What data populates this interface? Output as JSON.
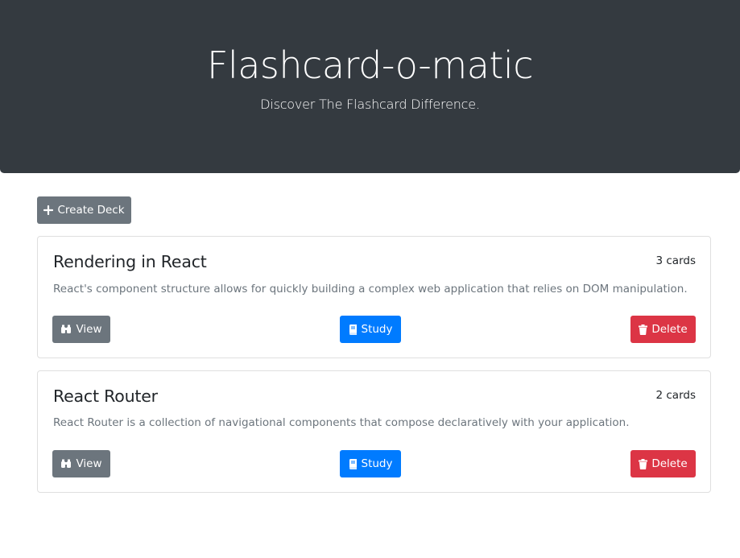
{
  "header": {
    "title": "Flashcard-o-matic",
    "subtitle": "Discover The Flashcard Difference."
  },
  "create_deck": {
    "label": "Create Deck",
    "icon": "plus-icon"
  },
  "decks": [
    {
      "title": "Rendering in React",
      "count": "3 cards",
      "description": "React's component structure allows for quickly building a complex web application that relies on DOM manipulation.",
      "view_label": "View",
      "study_label": "Study",
      "delete_label": "Delete"
    },
    {
      "title": "React Router",
      "count": "2 cards",
      "description": "React Router is a collection of navigational components that compose declaratively with your application.",
      "view_label": "View",
      "study_label": "Study",
      "delete_label": "Delete"
    }
  ],
  "colors": {
    "header_bg": "#343a40",
    "secondary": "#6c757d",
    "primary": "#007bff",
    "danger": "#dc3545"
  }
}
